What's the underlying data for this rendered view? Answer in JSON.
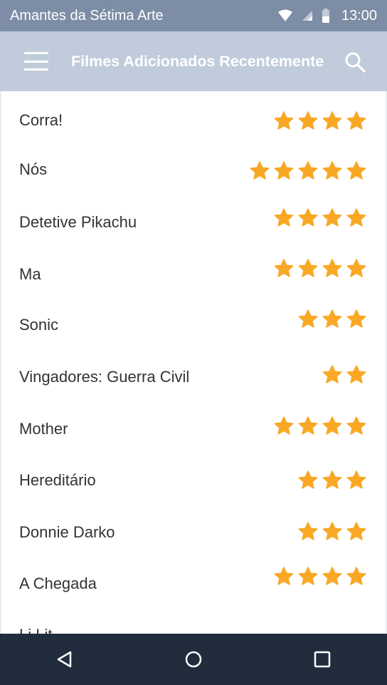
{
  "status_bar": {
    "app_name": "Amantes da Sétima Arte",
    "time": "13:00",
    "icons": [
      "wifi-icon",
      "signal-icon",
      "battery-icon"
    ]
  },
  "app_bar": {
    "title": "Filmes Adicionados Recentemente",
    "menu_icon": "hamburger-menu-icon",
    "search_icon": "search-icon"
  },
  "colors": {
    "status_bar": "#7d8da5",
    "app_bar": "#c0ccdb",
    "star": "#f9a825",
    "nav_bar": "#212d3d"
  },
  "movies": [
    {
      "title": "Corra!",
      "rating": 4
    },
    {
      "title": "Nós",
      "rating": 5
    },
    {
      "title": "Detetive Pikachu",
      "rating": 4
    },
    {
      "title": "Ma",
      "rating": 4
    },
    {
      "title": "Sonic",
      "rating": 3
    },
    {
      "title": "Vingadores: Guerra Civil",
      "rating": 2
    },
    {
      "title": "Mother",
      "rating": 4
    },
    {
      "title": "Hereditário",
      "rating": 3
    },
    {
      "title": "Donnie Darko",
      "rating": 3
    },
    {
      "title": "A Chegada",
      "rating": 4
    },
    {
      "title": "Li Lit",
      "rating": 0
    }
  ],
  "nav_bar": {
    "buttons": [
      "back-icon",
      "home-icon",
      "recents-icon"
    ]
  }
}
